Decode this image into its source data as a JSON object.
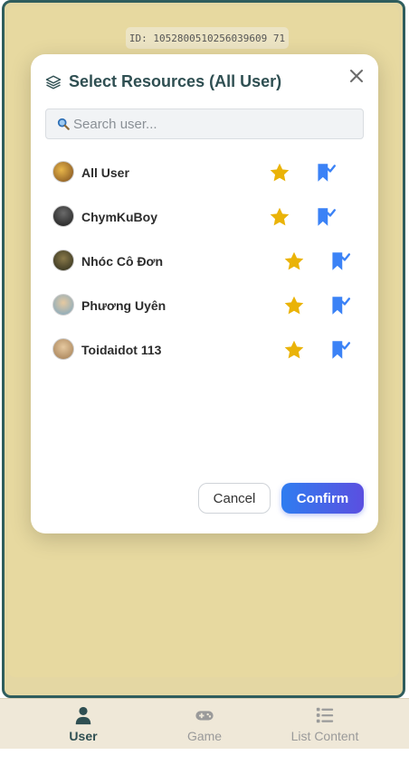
{
  "session": {
    "id_text": "ID: 1052800510256039609 71"
  },
  "modal": {
    "title": "Select Resources (All User)",
    "search_placeholder": "Search user...",
    "users": [
      {
        "name": "All User",
        "starred": true,
        "bookmarked": true
      },
      {
        "name": "ChymKuBoy",
        "starred": true,
        "bookmarked": true
      },
      {
        "name": "Nhóc Cô Đơn",
        "starred": true,
        "bookmarked": true
      },
      {
        "name": "Phương Uyên",
        "starred": true,
        "bookmarked": true
      },
      {
        "name": "Toidaidot 113",
        "starred": true,
        "bookmarked": true
      }
    ],
    "cancel_label": "Cancel",
    "confirm_label": "Confirm"
  },
  "bottom_nav": {
    "items": [
      {
        "label": "User",
        "icon": "user-icon",
        "active": true
      },
      {
        "label": "Game",
        "icon": "gamepad-icon",
        "active": false
      },
      {
        "label": "List Content",
        "icon": "list-icon",
        "active": false
      }
    ]
  },
  "colors": {
    "background": "#e4d7a3",
    "frame_border": "#2f5d5d",
    "accent": "#2f7df0",
    "star": "#eab308",
    "bookmark": "#3b82f6",
    "title": "#2f4f52"
  }
}
